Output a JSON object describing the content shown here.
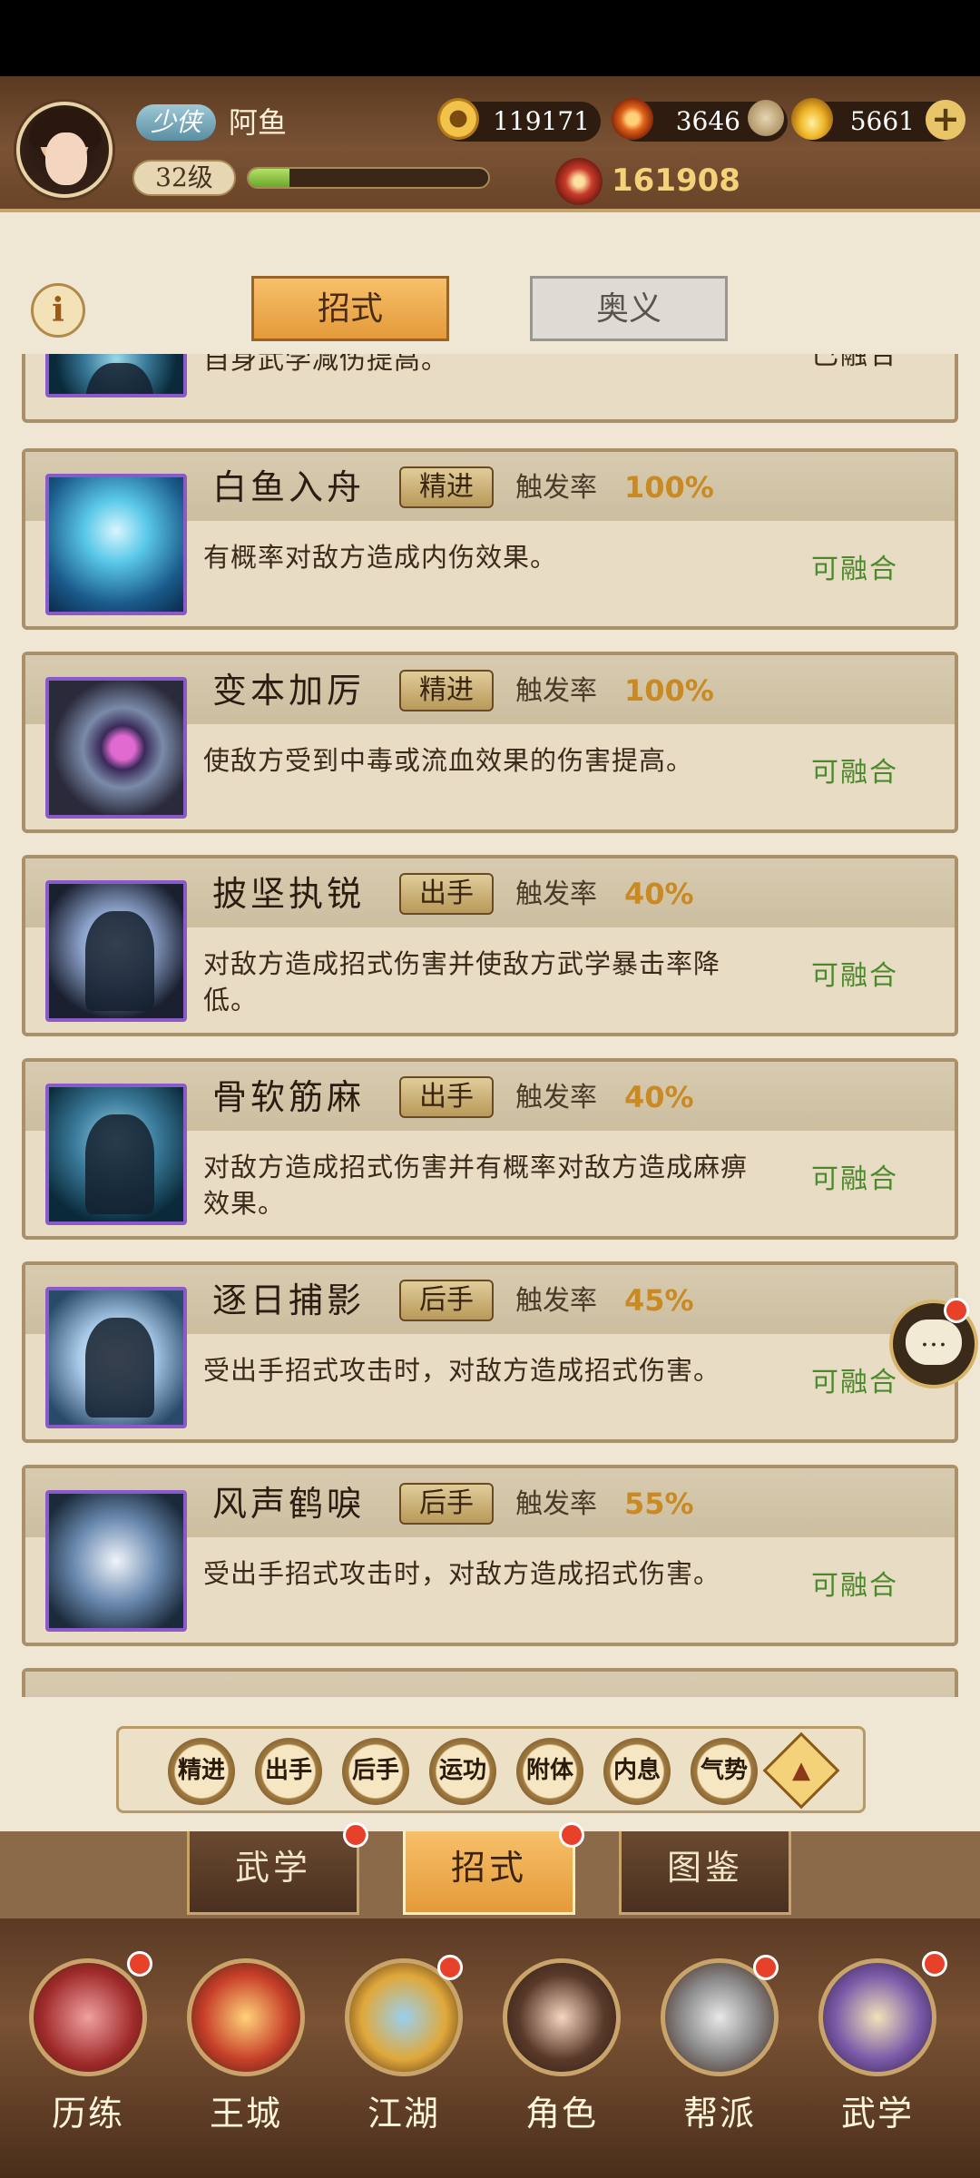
{
  "player": {
    "title": "少侠",
    "name": "阿鱼",
    "level": "32级",
    "exp_fraction": 0.17
  },
  "resources": {
    "coins": "119171",
    "embers": "3646",
    "ingots": "5661",
    "power": "161908"
  },
  "top_tabs": {
    "active": "招式",
    "inactive": "奥义"
  },
  "skills": [
    {
      "name": "",
      "tag": "",
      "rate_label": "",
      "rate": "",
      "desc": "自身武学减伤提高。",
      "status": "已融合"
    },
    {
      "name": "白鱼入舟",
      "tag": "精进",
      "rate_label": "触发率",
      "rate": "100%",
      "desc": "有概率对敌方造成内伤效果。",
      "status": "可融合"
    },
    {
      "name": "变本加厉",
      "tag": "精进",
      "rate_label": "触发率",
      "rate": "100%",
      "desc": "使敌方受到中毒或流血效果的伤害提高。",
      "status": "可融合"
    },
    {
      "name": "披坚执锐",
      "tag": "出手",
      "rate_label": "触发率",
      "rate": "40%",
      "desc": "对敌方造成招式伤害并使敌方武学暴击率降低。",
      "status": "可融合"
    },
    {
      "name": "骨软筋麻",
      "tag": "出手",
      "rate_label": "触发率",
      "rate": "40%",
      "desc": "对敌方造成招式伤害并有概率对敌方造成麻痹效果。",
      "status": "可融合"
    },
    {
      "name": "逐日捕影",
      "tag": "后手",
      "rate_label": "触发率",
      "rate": "45%",
      "desc": "受出手招式攻击时，对敌方造成招式伤害。",
      "status": "可融合"
    },
    {
      "name": "风声鹤唳",
      "tag": "后手",
      "rate_label": "触发率",
      "rate": "55%",
      "desc": "受出手招式攻击时，对敌方造成招式伤害。",
      "status": "可融合"
    }
  ],
  "filters": [
    "精进",
    "出手",
    "后手",
    "运功",
    "附体",
    "内息",
    "气势"
  ],
  "chat_icon": "…",
  "sub_tabs": [
    "武学",
    "招式",
    "图鉴"
  ],
  "nav": [
    "历练",
    "王城",
    "江湖",
    "角色",
    "帮派",
    "武学"
  ],
  "icons": [
    "coin-icon",
    "ember-icon",
    "ingot-icon",
    "plus-icon",
    "power-icon",
    "info-icon",
    "chat-icon",
    "collapse-arrow-icon"
  ]
}
